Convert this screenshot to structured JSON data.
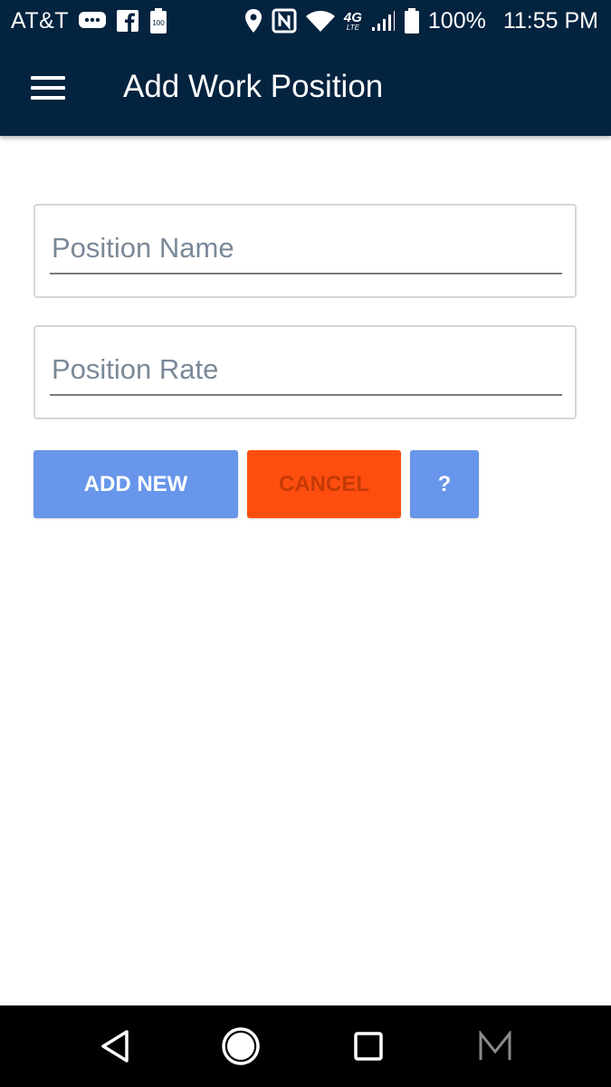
{
  "status_bar": {
    "carrier": "AT&T",
    "battery_icon_text": "100",
    "battery_percent": "100%",
    "time": "11:55 PM",
    "network": "4G",
    "network_sub": "LTE",
    "icons": [
      "message-icon",
      "facebook-icon",
      "battery-saver-icon",
      "location-icon",
      "nfc-icon",
      "wifi-icon",
      "4g-lte-icon",
      "signal-icon",
      "battery-icon"
    ]
  },
  "app_bar": {
    "title": "Add Work Position",
    "menu_icon": "hamburger-menu-icon"
  },
  "form": {
    "position_name": {
      "placeholder": "Position Name",
      "value": ""
    },
    "position_rate": {
      "placeholder": "Position Rate",
      "value": ""
    }
  },
  "buttons": {
    "add_new": "ADD NEW",
    "cancel": "CANCEL",
    "help": "?"
  },
  "nav_bar": {
    "icons": [
      "back-icon",
      "home-icon",
      "recent-apps-icon",
      "m-app-icon"
    ]
  },
  "colors": {
    "header_bg": "#04233f",
    "primary_button": "#6796ea",
    "cancel_button": "#fe4e0f",
    "cancel_text": "#c33a06",
    "placeholder": "#7a8898"
  }
}
